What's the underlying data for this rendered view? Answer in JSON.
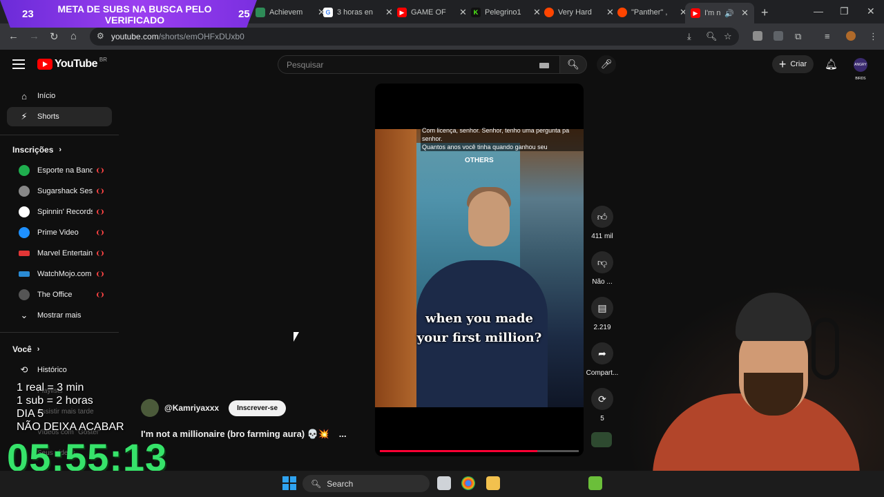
{
  "overlay_banner": {
    "left_count": "23",
    "right_count": "25",
    "text": "META DE SUBS NA BUSCA PELO VERIFICADO"
  },
  "tabs": [
    {
      "label": "Achievem",
      "favicon_color": "#2e8b57"
    },
    {
      "label": "3 horas en",
      "favicon_color": "#4285f4"
    },
    {
      "label": "GAME OF",
      "favicon_color": "#ff0000"
    },
    {
      "label": "Pelegrino1",
      "favicon_color": "#53fc18"
    },
    {
      "label": "Very Hard",
      "favicon_color": "#ff4500"
    },
    {
      "label": "\"Panther\" ,",
      "favicon_color": "#ff4500"
    },
    {
      "label": "I'm no",
      "favicon_color": "#ff0000"
    }
  ],
  "address_bar": {
    "url_host": "youtube.com",
    "url_path": "/shorts/emOHFxDUxb0"
  },
  "masthead": {
    "logo_text": "YouTube",
    "country_code": "BR",
    "search_placeholder": "Pesquisar",
    "create_label": "Criar",
    "avatar_text": "ANGRY BIRDS"
  },
  "sidebar": {
    "main": [
      {
        "label": "Início",
        "icon": "home-icon"
      },
      {
        "label": "Shorts",
        "icon": "shorts-icon",
        "active": true
      }
    ],
    "subscriptions_title": "Inscrições",
    "subscriptions": [
      {
        "label": "Esporte na Band",
        "color": "#1fae4e"
      },
      {
        "label": "Sugarshack Ses...",
        "color": "#888888"
      },
      {
        "label": "Spinnin' Records",
        "color": "#ffffff"
      },
      {
        "label": "Prime Video",
        "color": "#1e90ff"
      },
      {
        "label": "Marvel Entertain...",
        "color": "#e23636"
      },
      {
        "label": "WatchMojo.com",
        "color": "#2a8bd4"
      },
      {
        "label": "The Office",
        "color": "#555555"
      }
    ],
    "show_more": "Mostrar mais",
    "you_title": "Você",
    "you_items": [
      {
        "label": "Histórico"
      }
    ],
    "ghost_items": [
      "Playlists",
      "Assistir mais tarde",
      "Vídeos com \"Gostei\"",
      "Seus vídeos"
    ]
  },
  "short": {
    "subtitle_text": "Com licença, senhor.  Senhor, tenho uma pergunta pa senhor.\nQuantos anos você tinha quando ganhou seu",
    "video_label": "OTHERS",
    "caption_line1": "when you made",
    "caption_line2": "your first million?",
    "progress": 0.79,
    "channel": "@Kamriyaxxx",
    "subscribe_label": "Inscrever-se",
    "title": "I'm not a millionaire (bro farming aura) 💀💥",
    "more_label": "...",
    "likes": "411 mil",
    "dislike_label": "Não ...",
    "comments": "2.219",
    "share_label": "Compart...",
    "remix_count": "5"
  },
  "stream_overlay": {
    "rules": [
      "1 real = 3 min",
      "1 sub = 2 horas",
      "DIA 5",
      "NÃO DEIXA ACABAR"
    ],
    "timer": "05:55:13"
  },
  "taskbar": {
    "search_label": "Search"
  }
}
